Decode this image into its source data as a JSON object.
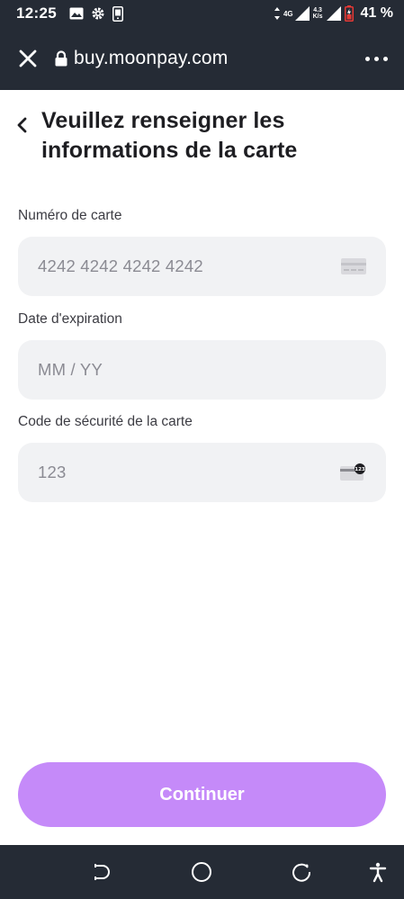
{
  "status_bar": {
    "time": "12:25",
    "network_type": "4G",
    "net_speed_value": "4.3",
    "net_speed_unit": "K/s",
    "battery_percent": "41 %"
  },
  "browser": {
    "url": "buy.moonpay.com"
  },
  "page": {
    "title": "Veuillez renseigner les informations de la carte"
  },
  "form": {
    "card_number": {
      "label": "Numéro de carte",
      "placeholder": "4242 4242 4242 4242",
      "value": ""
    },
    "expiry": {
      "label": "Date d'expiration",
      "placeholder": "MM / YY",
      "value": ""
    },
    "security_code": {
      "label": "Code de sécurité de la carte",
      "placeholder": "123",
      "value": "",
      "icon_badge": "123"
    }
  },
  "actions": {
    "continue_label": "Continuer"
  },
  "colors": {
    "bar_background": "#252b35",
    "primary_button": "#c58af9",
    "field_background": "#f1f2f4",
    "battery_alert": "#e53935"
  },
  "icons": {
    "close": "close-icon",
    "lock": "lock-icon",
    "menu": "more-horizontal-icon",
    "back": "chevron-left-icon",
    "card": "credit-card-icon",
    "cvc": "card-cvc-icon"
  }
}
